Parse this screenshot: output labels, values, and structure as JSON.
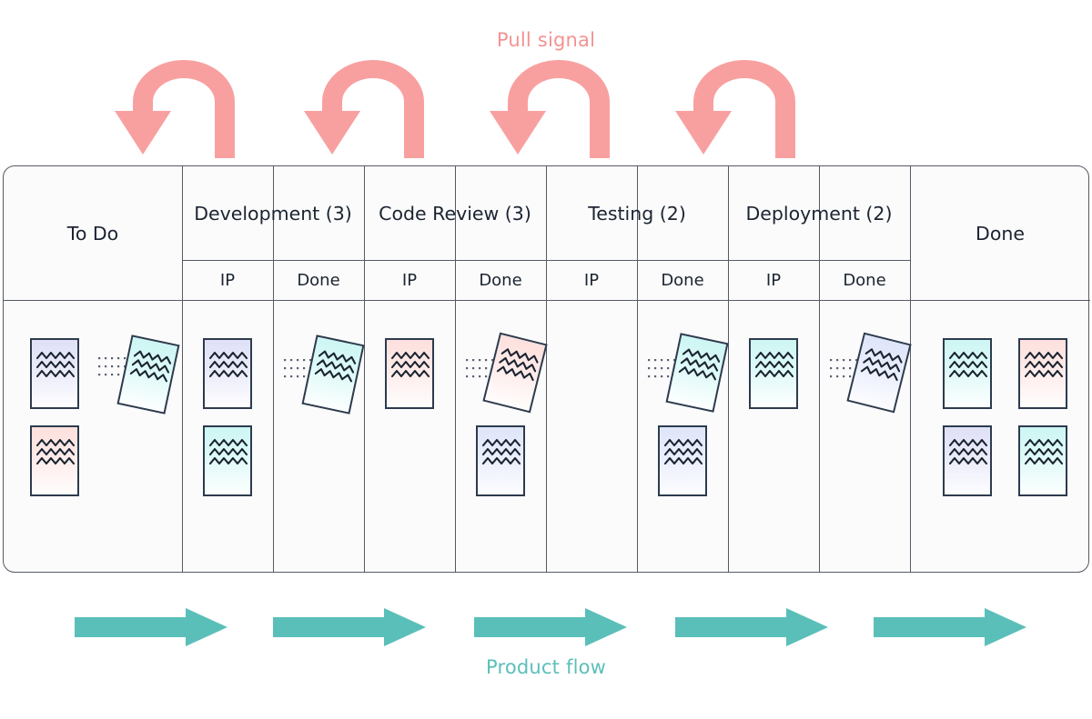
{
  "diagram": {
    "title_top": "Pull signal",
    "title_bottom": "Product flow",
    "accent_pull": "#f8a0a0",
    "accent_flow": "#5bbfb9",
    "board_border": "#555a63",
    "card_border": "#2d3b4d"
  },
  "board": {
    "columns": [
      {
        "id": "todo",
        "label": "To Do",
        "sub": [],
        "wip": null
      },
      {
        "id": "development",
        "label": "Development (3)",
        "sub": [
          "IP",
          "Done"
        ],
        "wip": 3
      },
      {
        "id": "codereview",
        "label": "Code Review (3)",
        "sub": [
          "IP",
          "Done"
        ],
        "wip": 3
      },
      {
        "id": "testing",
        "label": "Testing (2)",
        "sub": [
          "IP",
          "Done"
        ],
        "wip": 2
      },
      {
        "id": "deployment",
        "label": "Deployment (2)",
        "sub": [
          "IP",
          "Done"
        ],
        "wip": 2
      },
      {
        "id": "done",
        "label": "Done",
        "sub": [],
        "wip": null
      }
    ],
    "cells": [
      {
        "id": "todo",
        "cards": 3
      },
      {
        "id": "development-ip",
        "cards": 2
      },
      {
        "id": "development-done",
        "cards": 1
      },
      {
        "id": "codereview-ip",
        "cards": 1
      },
      {
        "id": "codereview-done",
        "cards": 2
      },
      {
        "id": "testing-ip",
        "cards": 0
      },
      {
        "id": "testing-done",
        "cards": 2
      },
      {
        "id": "deployment-ip",
        "cards": 1
      },
      {
        "id": "deployment-done",
        "cards": 1
      },
      {
        "id": "done",
        "cards": 4
      }
    ]
  },
  "pull_arrows": {
    "count": 4
  },
  "flow_arrows": {
    "count": 5
  }
}
